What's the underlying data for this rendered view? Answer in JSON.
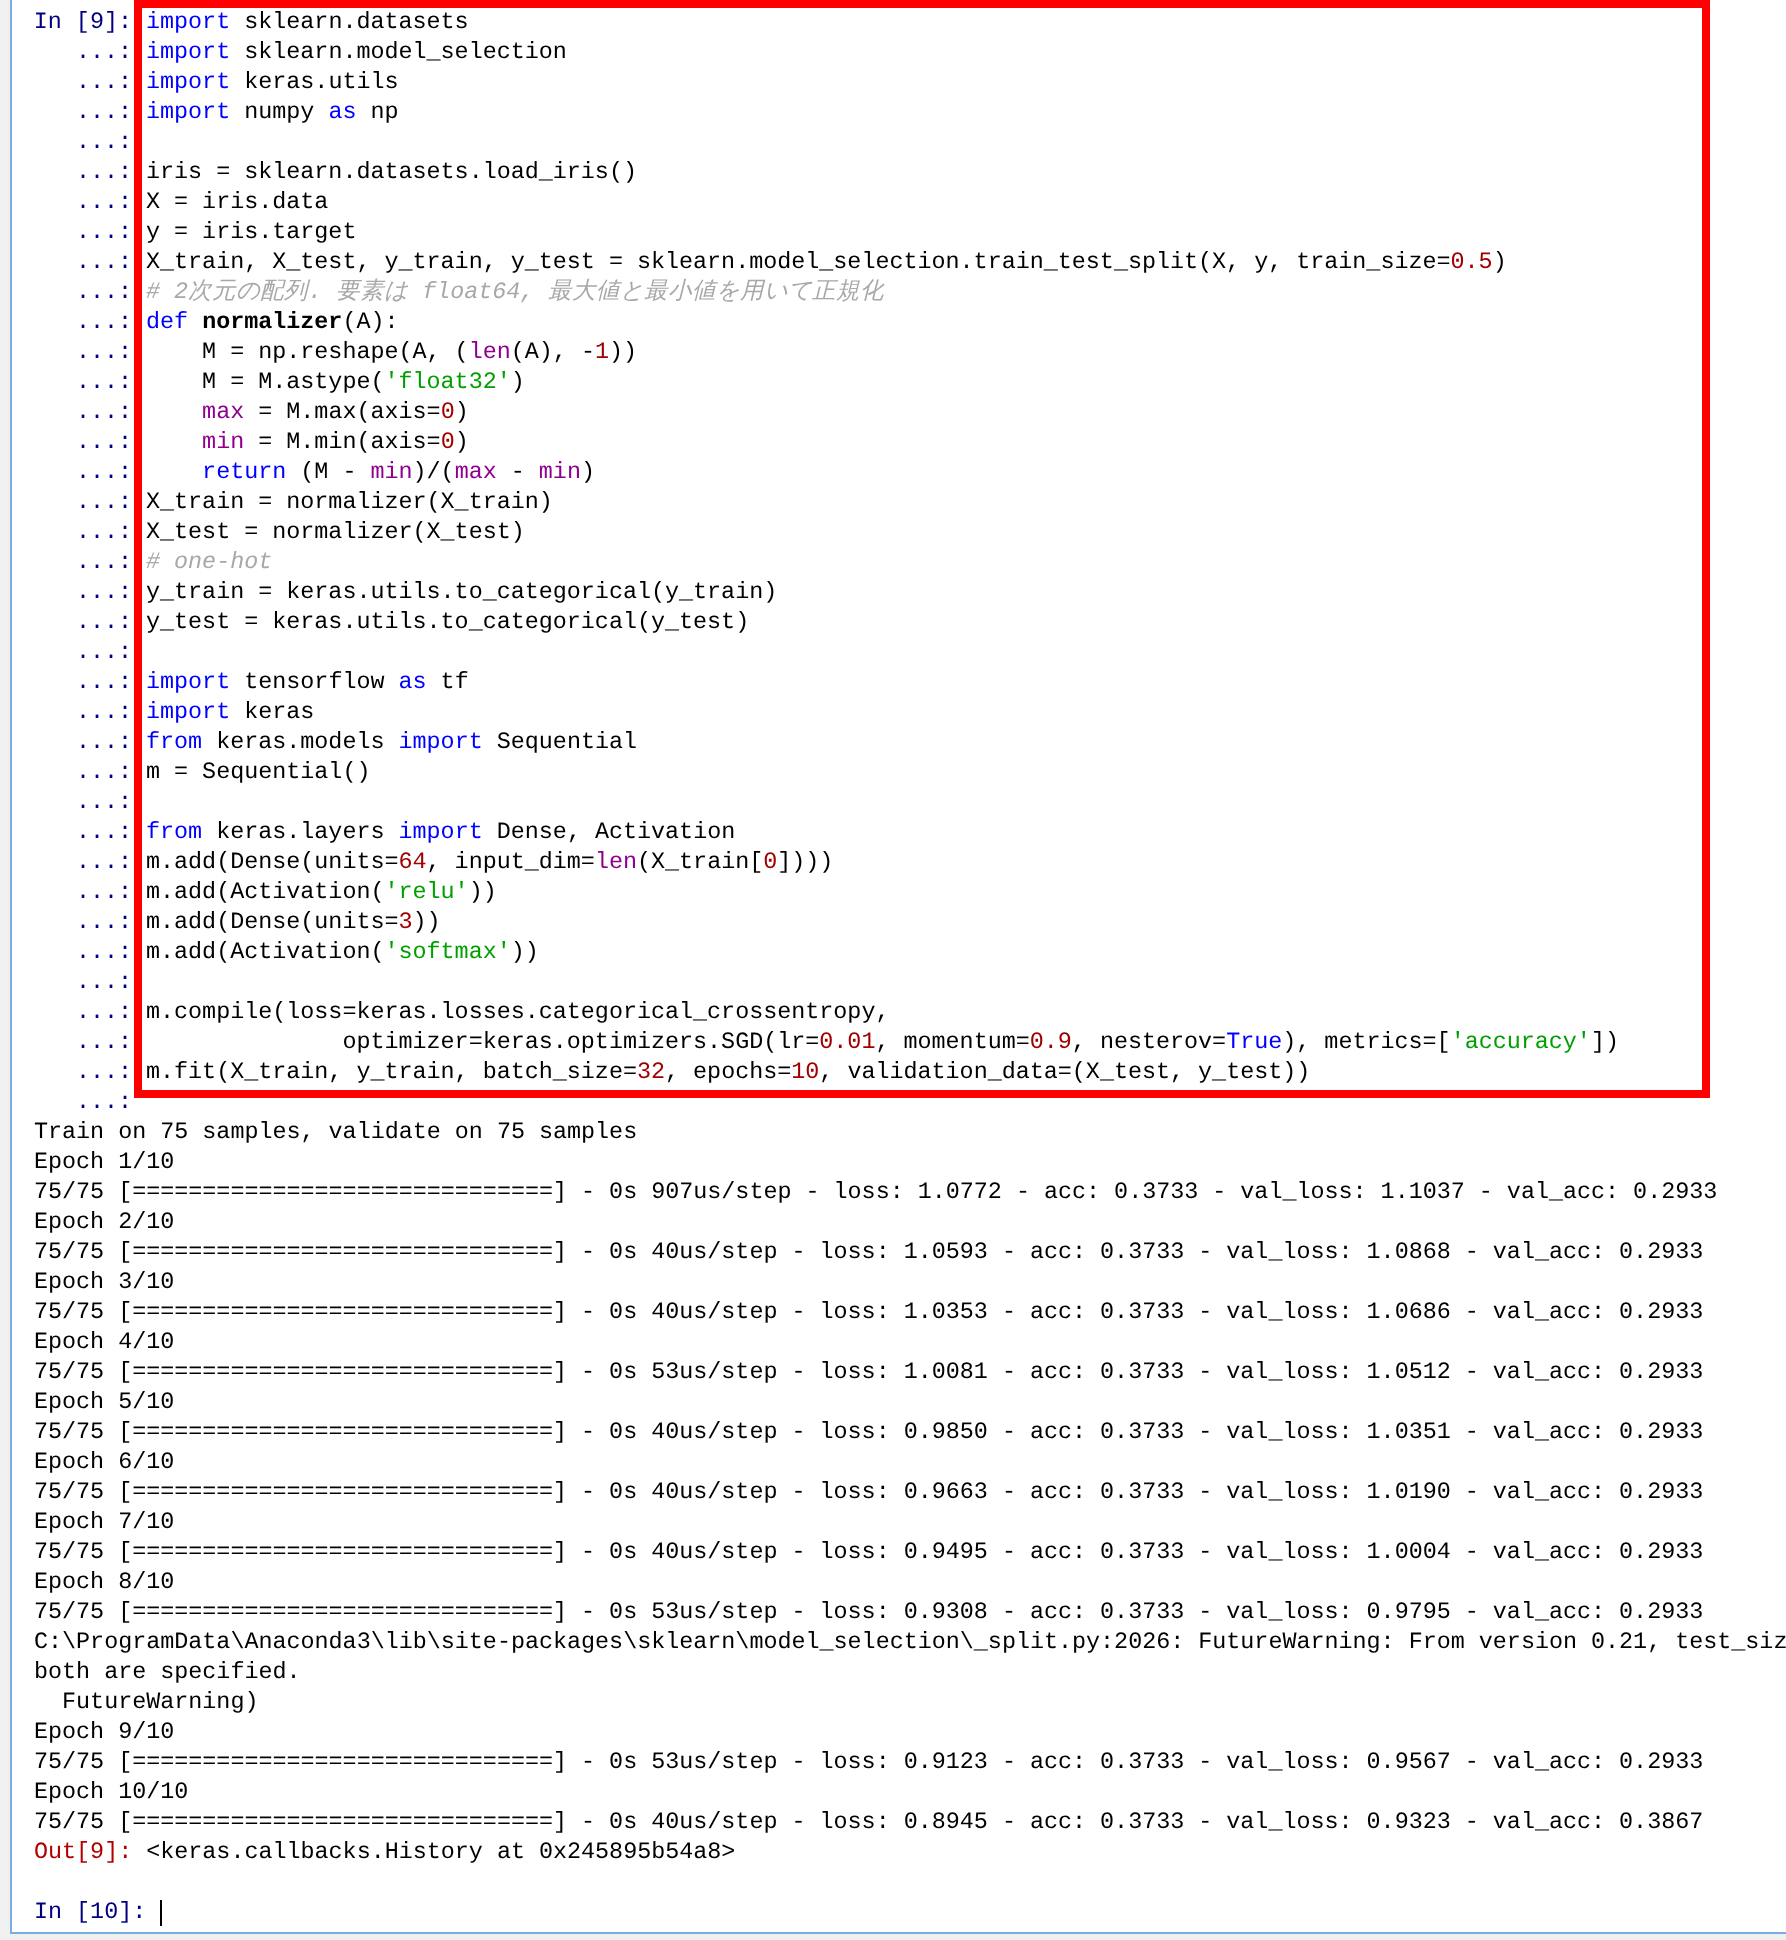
{
  "input_cell": {
    "lines": [
      {
        "prompt": "In [9]:",
        "tokens": [
          {
            "kind": "keyword",
            "text": "import"
          },
          {
            "kind": "plain",
            "text": " sklearn.datasets"
          }
        ]
      },
      {
        "prompt": "...:",
        "tokens": [
          {
            "kind": "keyword",
            "text": "import"
          },
          {
            "kind": "plain",
            "text": " sklearn.model_selection"
          }
        ]
      },
      {
        "prompt": "...:",
        "tokens": [
          {
            "kind": "keyword",
            "text": "import"
          },
          {
            "kind": "plain",
            "text": " keras.utils"
          }
        ]
      },
      {
        "prompt": "...:",
        "tokens": [
          {
            "kind": "keyword",
            "text": "import"
          },
          {
            "kind": "plain",
            "text": " numpy "
          },
          {
            "kind": "keyword",
            "text": "as"
          },
          {
            "kind": "plain",
            "text": " np"
          }
        ]
      },
      {
        "prompt": "...:"
      },
      {
        "prompt": "...:",
        "tokens": [
          {
            "kind": "plain",
            "text": "iris = sklearn.datasets.load_iris()"
          }
        ]
      },
      {
        "prompt": "...:",
        "tokens": [
          {
            "kind": "plain",
            "text": "X = iris.data"
          }
        ]
      },
      {
        "prompt": "...:",
        "tokens": [
          {
            "kind": "plain",
            "text": "y = iris.target"
          }
        ]
      },
      {
        "prompt": "...:",
        "tokens": [
          {
            "kind": "plain",
            "text": "X_train, X_test, y_train, y_test = sklearn.model_selection.train_test_split(X, y, train_size="
          },
          {
            "kind": "number",
            "text": "0.5"
          },
          {
            "kind": "plain",
            "text": ")"
          }
        ]
      },
      {
        "prompt": "...:",
        "tokens": [
          {
            "kind": "comment",
            "text": "# 2次元の配列. 要素は float64, 最大値と最小値を用いて正規化"
          }
        ]
      },
      {
        "prompt": "...:",
        "tokens": [
          {
            "kind": "keyword",
            "text": "def "
          },
          {
            "kind": "function",
            "text": "normalizer"
          },
          {
            "kind": "plain",
            "text": "(A):"
          }
        ]
      },
      {
        "prompt": "...:",
        "tokens": [
          {
            "kind": "plain",
            "text": "    M = np.reshape(A, ("
          },
          {
            "kind": "builtin",
            "text": "len"
          },
          {
            "kind": "plain",
            "text": "(A), -"
          },
          {
            "kind": "number",
            "text": "1"
          },
          {
            "kind": "plain",
            "text": "))"
          }
        ]
      },
      {
        "prompt": "...:",
        "tokens": [
          {
            "kind": "plain",
            "text": "    M = M.astype("
          },
          {
            "kind": "string",
            "text": "'float32'"
          },
          {
            "kind": "plain",
            "text": ")"
          }
        ]
      },
      {
        "prompt": "...:",
        "tokens": [
          {
            "kind": "builtin",
            "text": "    max"
          },
          {
            "kind": "plain",
            "text": " = M.max(axis="
          },
          {
            "kind": "number",
            "text": "0"
          },
          {
            "kind": "plain",
            "text": ")"
          }
        ]
      },
      {
        "prompt": "...:",
        "tokens": [
          {
            "kind": "builtin",
            "text": "    min"
          },
          {
            "kind": "plain",
            "text": " = M.min(axis="
          },
          {
            "kind": "number",
            "text": "0"
          },
          {
            "kind": "plain",
            "text": ")"
          }
        ]
      },
      {
        "prompt": "...:",
        "tokens": [
          {
            "kind": "keyword",
            "text": "    return"
          },
          {
            "kind": "plain",
            "text": " (M - "
          },
          {
            "kind": "builtin",
            "text": "min"
          },
          {
            "kind": "plain",
            "text": ")/("
          },
          {
            "kind": "builtin",
            "text": "max"
          },
          {
            "kind": "plain",
            "text": " - "
          },
          {
            "kind": "builtin",
            "text": "min"
          },
          {
            "kind": "plain",
            "text": ")"
          }
        ]
      },
      {
        "prompt": "...:",
        "tokens": [
          {
            "kind": "plain",
            "text": "X_train = normalizer(X_train)"
          }
        ]
      },
      {
        "prompt": "...:",
        "tokens": [
          {
            "kind": "plain",
            "text": "X_test = normalizer(X_test)"
          }
        ]
      },
      {
        "prompt": "...:",
        "tokens": [
          {
            "kind": "comment",
            "text": "# one-hot"
          }
        ]
      },
      {
        "prompt": "...:",
        "tokens": [
          {
            "kind": "plain",
            "text": "y_train = keras.utils.to_categorical(y_train)"
          }
        ]
      },
      {
        "prompt": "...:",
        "tokens": [
          {
            "kind": "plain",
            "text": "y_test = keras.utils.to_categorical(y_test)"
          }
        ]
      },
      {
        "prompt": "...:"
      },
      {
        "prompt": "...:",
        "tokens": [
          {
            "kind": "keyword",
            "text": "import"
          },
          {
            "kind": "plain",
            "text": " tensorflow "
          },
          {
            "kind": "keyword",
            "text": "as"
          },
          {
            "kind": "plain",
            "text": " tf"
          }
        ]
      },
      {
        "prompt": "...:",
        "tokens": [
          {
            "kind": "keyword",
            "text": "import"
          },
          {
            "kind": "plain",
            "text": " keras"
          }
        ]
      },
      {
        "prompt": "...:",
        "tokens": [
          {
            "kind": "keyword",
            "text": "from"
          },
          {
            "kind": "plain",
            "text": " keras.models "
          },
          {
            "kind": "keyword",
            "text": "import"
          },
          {
            "kind": "plain",
            "text": " Sequential"
          }
        ]
      },
      {
        "prompt": "...:",
        "tokens": [
          {
            "kind": "plain",
            "text": "m = Sequential()"
          }
        ]
      },
      {
        "prompt": "...:"
      },
      {
        "prompt": "...:",
        "tokens": [
          {
            "kind": "keyword",
            "text": "from"
          },
          {
            "kind": "plain",
            "text": " keras.layers "
          },
          {
            "kind": "keyword",
            "text": "import"
          },
          {
            "kind": "plain",
            "text": " Dense, Activation"
          }
        ]
      },
      {
        "prompt": "...:",
        "tokens": [
          {
            "kind": "plain",
            "text": "m.add(Dense(units="
          },
          {
            "kind": "number",
            "text": "64"
          },
          {
            "kind": "plain",
            "text": ", input_dim="
          },
          {
            "kind": "builtin",
            "text": "len"
          },
          {
            "kind": "plain",
            "text": "(X_train["
          },
          {
            "kind": "number",
            "text": "0"
          },
          {
            "kind": "plain",
            "text": "])))"
          }
        ]
      },
      {
        "prompt": "...:",
        "tokens": [
          {
            "kind": "plain",
            "text": "m.add(Activation("
          },
          {
            "kind": "string",
            "text": "'relu'"
          },
          {
            "kind": "plain",
            "text": "))"
          }
        ]
      },
      {
        "prompt": "...:",
        "tokens": [
          {
            "kind": "plain",
            "text": "m.add(Dense(units="
          },
          {
            "kind": "number",
            "text": "3"
          },
          {
            "kind": "plain",
            "text": "))"
          }
        ]
      },
      {
        "prompt": "...:",
        "tokens": [
          {
            "kind": "plain",
            "text": "m.add(Activation("
          },
          {
            "kind": "string",
            "text": "'softmax'"
          },
          {
            "kind": "plain",
            "text": "))"
          }
        ]
      },
      {
        "prompt": "...:"
      },
      {
        "prompt": "...:",
        "tokens": [
          {
            "kind": "plain",
            "text": "m.compile(loss=keras.losses.categorical_crossentropy,"
          }
        ]
      },
      {
        "prompt": "...:",
        "tokens": [
          {
            "kind": "plain",
            "text": "              optimizer=keras.optimizers.SGD(lr="
          },
          {
            "kind": "number",
            "text": "0.01"
          },
          {
            "kind": "plain",
            "text": ", momentum="
          },
          {
            "kind": "number",
            "text": "0.9"
          },
          {
            "kind": "plain",
            "text": ", nesterov="
          },
          {
            "kind": "keyword",
            "text": "True"
          },
          {
            "kind": "plain",
            "text": "), metrics=["
          },
          {
            "kind": "string",
            "text": "'accuracy'"
          },
          {
            "kind": "plain",
            "text": "])"
          }
        ]
      },
      {
        "prompt": "...:",
        "tokens": [
          {
            "kind": "plain",
            "text": "m.fit(X_train, y_train, batch_size="
          },
          {
            "kind": "number",
            "text": "32"
          },
          {
            "kind": "plain",
            "text": ", epochs="
          },
          {
            "kind": "number",
            "text": "10"
          },
          {
            "kind": "plain",
            "text": ", validation_data=(X_test, y_test))"
          }
        ]
      },
      {
        "prompt": "...:"
      }
    ]
  },
  "output_lines": [
    "Train on 75 samples, validate on 75 samples",
    "Epoch 1/10",
    "75/75 [==============================] - 0s 907us/step - loss: 1.0772 - acc: 0.3733 - val_loss: 1.1037 - val_acc: 0.2933",
    "Epoch 2/10",
    "75/75 [==============================] - 0s 40us/step - loss: 1.0593 - acc: 0.3733 - val_loss: 1.0868 - val_acc: 0.2933",
    "Epoch 3/10",
    "75/75 [==============================] - 0s 40us/step - loss: 1.0353 - acc: 0.3733 - val_loss: 1.0686 - val_acc: 0.2933",
    "Epoch 4/10",
    "75/75 [==============================] - 0s 53us/step - loss: 1.0081 - acc: 0.3733 - val_loss: 1.0512 - val_acc: 0.2933",
    "Epoch 5/10",
    "75/75 [==============================] - 0s 40us/step - loss: 0.9850 - acc: 0.3733 - val_loss: 1.0351 - val_acc: 0.2933",
    "Epoch 6/10",
    "75/75 [==============================] - 0s 40us/step - loss: 0.9663 - acc: 0.3733 - val_loss: 1.0190 - val_acc: 0.2933",
    "Epoch 7/10",
    "75/75 [==============================] - 0s 40us/step - loss: 0.9495 - acc: 0.3733 - val_loss: 1.0004 - val_acc: 0.2933",
    "Epoch 8/10",
    "75/75 [==============================] - 0s 53us/step - loss: 0.9308 - acc: 0.3733 - val_loss: 0.9795 - val_acc: 0.2933",
    "C:\\ProgramData\\Anaconda3\\lib\\site-packages\\sklearn\\model_selection\\_split.py:2026: FutureWarning: From version 0.21, test_siz",
    "both are specified.",
    "  FutureWarning)",
    "Epoch 9/10",
    "75/75 [==============================] - 0s 53us/step - loss: 0.9123 - acc: 0.3733 - val_loss: 0.9567 - val_acc: 0.2933",
    "Epoch 10/10",
    "75/75 [==============================] - 0s 40us/step - loss: 0.8945 - acc: 0.3733 - val_loss: 0.9323 - val_acc: 0.3867"
  ],
  "result": {
    "prompt": "Out[9]:",
    "value": "<keras.callbacks.History at 0x245895b54a8>"
  },
  "next_input": {
    "prompt": "In [10]:"
  }
}
